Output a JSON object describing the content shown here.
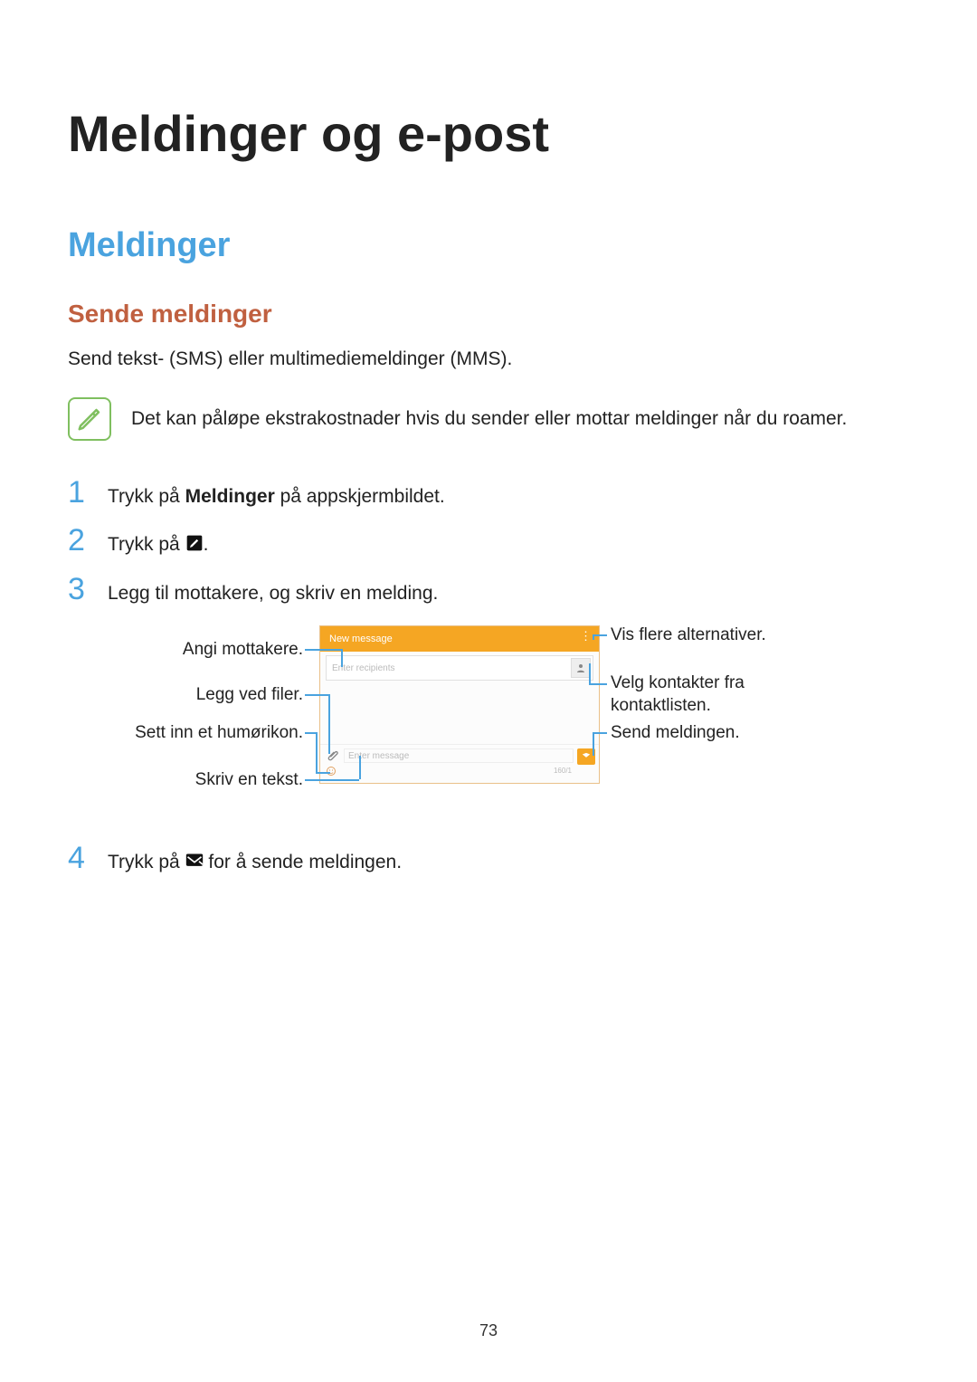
{
  "h1": "Meldinger og e-post",
  "h2": "Meldinger",
  "h3": "Sende meldinger",
  "intro": "Send tekst- (SMS) eller multimediemeldinger (MMS).",
  "note": "Det kan påløpe ekstrakostnader hvis du sender eller mottar meldinger når du roamer.",
  "steps": {
    "s1_a": "Trykk på ",
    "s1_b": "Meldinger",
    "s1_c": " på appskjermbildet.",
    "s2_a": "Trykk på ",
    "s2_b": ".",
    "s3": "Legg til mottakere, og skriv en melding.",
    "s4_a": "Trykk på ",
    "s4_b": " for å sende meldingen."
  },
  "nums": {
    "n1": "1",
    "n2": "2",
    "n3": "3",
    "n4": "4"
  },
  "callouts": {
    "left1": "Angi mottakere.",
    "left2": "Legg ved filer.",
    "left3": "Sett inn et humørikon.",
    "left4": "Skriv en tekst.",
    "right1": "Vis flere alternativer.",
    "right2": "Velg kontakter fra kontaktlisten.",
    "right3": "Send meldingen."
  },
  "phone": {
    "header": "New message",
    "recipient_placeholder": "Enter recipients",
    "message_placeholder": "Enter message",
    "count": "160/1"
  },
  "page_number": "73"
}
